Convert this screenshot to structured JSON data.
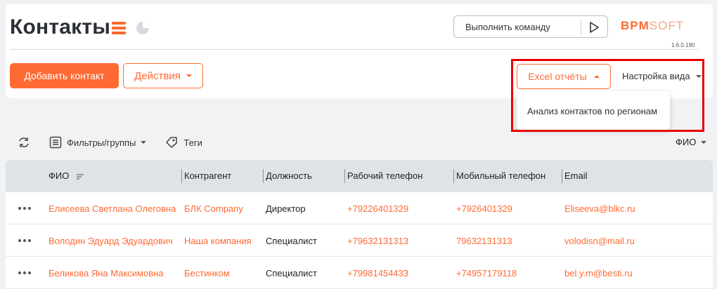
{
  "page": {
    "title": "Контакты",
    "command": {
      "placeholder": "Выполнить команду"
    },
    "brand": {
      "bold": "BPM",
      "light": "SOFT",
      "version": "1.6.0.190"
    }
  },
  "toolbar": {
    "add_label": "Добавить контакт",
    "actions_label": "Действия",
    "excel_label": "Excel отчёты",
    "view_label": "Настройка вида"
  },
  "excel_menu": {
    "items": [
      "Анализ контактов по регионам"
    ]
  },
  "filters": {
    "filters_label": "Фильтры/группы",
    "tags_label": "Теги",
    "sort_label": "ФИО"
  },
  "table": {
    "columns": [
      "ФИО",
      "Контрагент",
      "Должность",
      "Рабочий телефон",
      "Мобильный телефон",
      "Email"
    ],
    "rows": [
      {
        "name": "Елисеева Светлана Олеговна",
        "account": "БЛК Company",
        "position": "Директор",
        "work_phone": "+79226401329",
        "mobile_phone": "+7926401329",
        "email": "Eliseeva@blkc.ru"
      },
      {
        "name": "Володин Эдуард Эдуардович",
        "account": "Наша компания",
        "position": "Специалист",
        "work_phone": "+79632131313",
        "mobile_phone": "79632131313",
        "email": "volodisn@mail.ru"
      },
      {
        "name": "Беликова Яна Максимовна",
        "account": "Бестинком",
        "position": "Специалист",
        "work_phone": "+79981454433",
        "mobile_phone": "+74957179118",
        "email": "bel.y.m@besti.ru"
      }
    ]
  },
  "colors": {
    "accent": "#ff6a34",
    "highlight_frame": "#e60000",
    "header_bg": "#dfe2e7"
  },
  "icons": [
    "menu-icon",
    "pie-chart-icon",
    "play-icon",
    "refresh-icon",
    "filter-list-icon",
    "tag-icon",
    "sort-icon",
    "more-dots-icon"
  ]
}
